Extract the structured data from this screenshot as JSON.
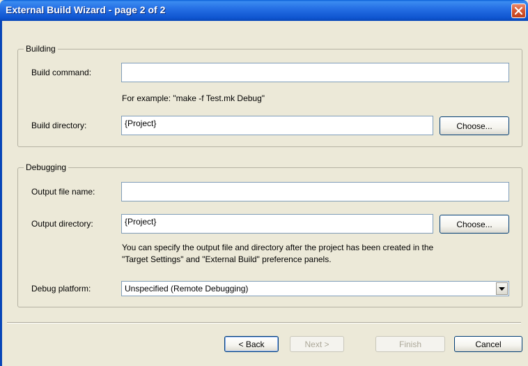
{
  "window": {
    "title": "External Build Wizard - page 2 of 2"
  },
  "building": {
    "group_label": "Building",
    "build_command_label": "Build command:",
    "build_command_value": "",
    "example_text": "For example: \"make -f Test.mk Debug\"",
    "build_directory_label": "Build directory:",
    "build_directory_value": "{Project}",
    "choose_label": "Choose..."
  },
  "debugging": {
    "group_label": "Debugging",
    "output_file_label": "Output file name:",
    "output_file_value": "",
    "output_directory_label": "Output directory:",
    "output_directory_value": "{Project}",
    "choose_label": "Choose...",
    "hint_line1": "You can specify the output file and directory after the project has been created in the",
    "hint_line2": "\"Target Settings\" and \"External Build\" preference panels.",
    "debug_platform_label": "Debug platform:",
    "debug_platform_value": "Unspecified (Remote Debugging)"
  },
  "footer": {
    "back_label": "< Back",
    "next_label": "Next >",
    "finish_label": "Finish",
    "cancel_label": "Cancel"
  },
  "colors": {
    "titlebar": "#2670e5",
    "background": "#ece9d8",
    "close_button": "#d65630"
  },
  "icons": {
    "close": "close-icon",
    "dropdown": "chevron-down-icon"
  }
}
